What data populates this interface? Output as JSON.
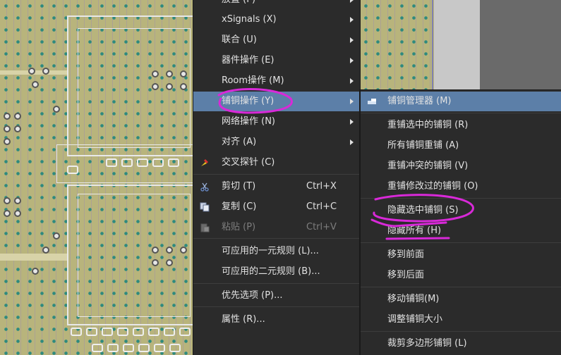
{
  "main_menu": {
    "items": [
      {
        "text": "放置 (P)",
        "shortcut": "",
        "submenu": true,
        "disabled": false,
        "icon": ""
      },
      {
        "text": "xSignals (X)",
        "shortcut": "",
        "submenu": true,
        "disabled": false,
        "icon": ""
      },
      {
        "text": "联合 (U)",
        "shortcut": "",
        "submenu": true,
        "disabled": false,
        "icon": ""
      },
      {
        "text": "器件操作 (E)",
        "shortcut": "",
        "submenu": true,
        "disabled": false,
        "icon": ""
      },
      {
        "text": "Room操作 (M)",
        "shortcut": "",
        "submenu": true,
        "disabled": false,
        "icon": ""
      },
      {
        "text": "铺铜操作 (Y)",
        "shortcut": "",
        "submenu": true,
        "disabled": false,
        "icon": "",
        "highlighted": true
      },
      {
        "text": "网络操作 (N)",
        "shortcut": "",
        "submenu": true,
        "disabled": false,
        "icon": ""
      },
      {
        "text": "对齐 (A)",
        "shortcut": "",
        "submenu": true,
        "disabled": false,
        "icon": ""
      },
      {
        "text": "交叉探针 (C)",
        "shortcut": "",
        "submenu": false,
        "disabled": false,
        "icon": "cross-probe-icon"
      },
      {
        "text": "剪切 (T)",
        "shortcut": "Ctrl+X",
        "submenu": false,
        "disabled": false,
        "icon": "scissors-icon"
      },
      {
        "text": "复制 (C)",
        "shortcut": "Ctrl+C",
        "submenu": false,
        "disabled": false,
        "icon": "copy-icon"
      },
      {
        "text": "粘贴 (P)",
        "shortcut": "Ctrl+V",
        "submenu": false,
        "disabled": true,
        "icon": "paste-icon"
      },
      {
        "text": "可应用的一元规则 (L)...",
        "shortcut": "",
        "submenu": false,
        "disabled": false,
        "icon": ""
      },
      {
        "text": "可应用的二元规则 (B)...",
        "shortcut": "",
        "submenu": false,
        "disabled": false,
        "icon": ""
      },
      {
        "text": "优先选项 (P)...",
        "shortcut": "",
        "submenu": false,
        "disabled": false,
        "icon": ""
      },
      {
        "text": "属性 (R)...",
        "shortcut": "",
        "submenu": false,
        "disabled": false,
        "icon": ""
      }
    ]
  },
  "sub_menu": {
    "items": [
      {
        "text": "铺铜管理器 (M)",
        "icon": "polygon-manager-icon",
        "highlighted": true
      },
      {
        "text": "重铺选中的铺铜 (R)"
      },
      {
        "text": "所有铺铜重铺 (A)"
      },
      {
        "text": "重铺冲突的铺铜 (V)"
      },
      {
        "text": "重铺修改过的铺铜 (O)"
      },
      {
        "text": "隐藏选中铺铜 (S)"
      },
      {
        "text": "隐藏所有 (H)"
      },
      {
        "text": "移到前面"
      },
      {
        "text": "移到后面"
      },
      {
        "text": "移动铺铜(M)"
      },
      {
        "text": "调整铺铜大小"
      },
      {
        "text": "裁剪多边形铺铜 (L)"
      }
    ]
  },
  "colors": {
    "menu_bg": "#2b2b2b",
    "highlight": "#5c7fa8",
    "annotation": "#d829d8",
    "pcb_board": "#b8b47c"
  }
}
